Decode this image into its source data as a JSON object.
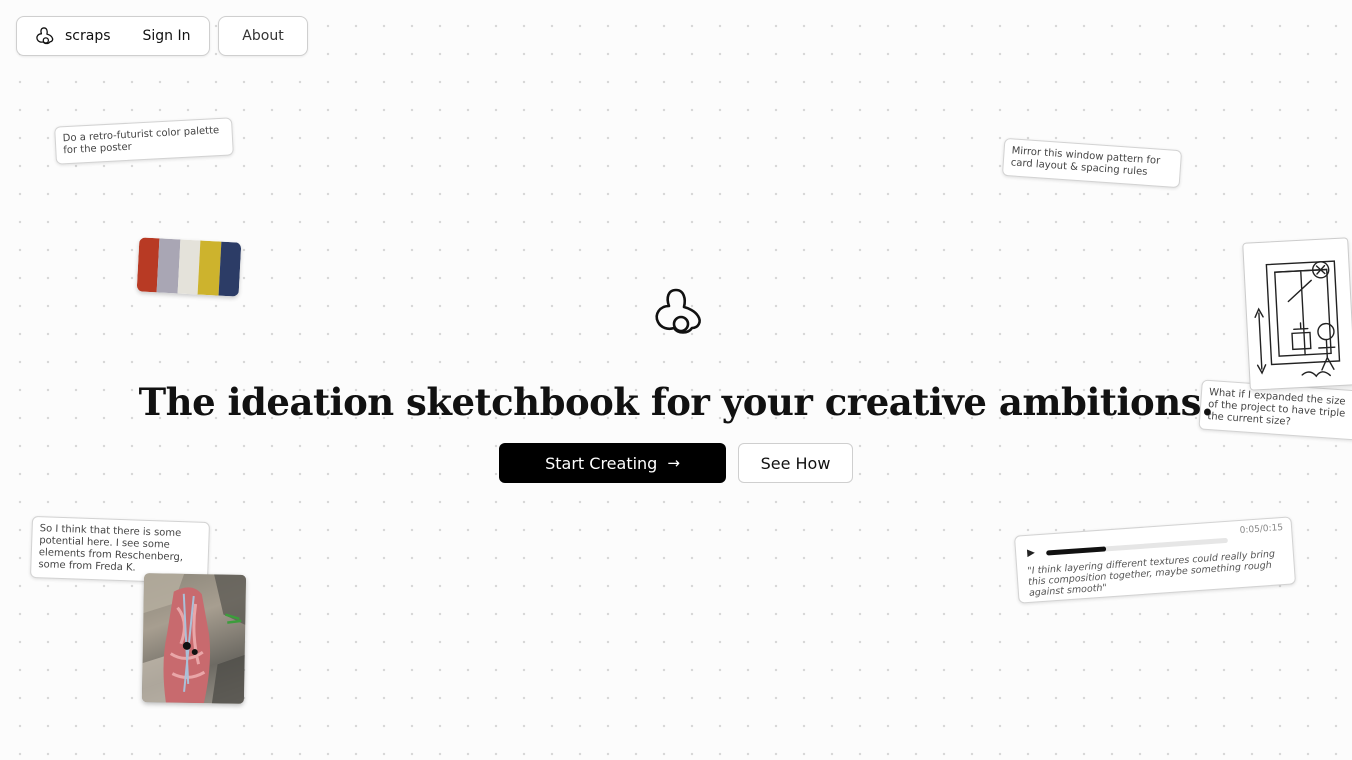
{
  "nav": {
    "brand": "scraps",
    "sign_in": "Sign In",
    "about": "About"
  },
  "hero": {
    "headline": "The ideation sketchbook for your creative ambitions.",
    "primary_button": "Start Creating",
    "primary_button_icon": "arrow-right-icon",
    "secondary_button": "See How"
  },
  "notes": {
    "palette_prompt": "Do a retro-futurist color palette for the poster",
    "window_pattern": "Mirror this window pattern for card layout & spacing rules",
    "expand_size": "What if I expanded the size of the project to have triple the current size?",
    "collage_comment": "So I think that there is some potential here. I see some elements from Reschenberg, some from Freda K."
  },
  "palette": {
    "colors": [
      "#b83a24",
      "#a9a6b4",
      "#e4e2da",
      "#cdb32d",
      "#2c3c66"
    ]
  },
  "audio": {
    "time": "0:05/0:15",
    "progress": 0.33,
    "quote": "\"I think layering different textures could really bring this composition together, maybe something rough against smooth\""
  },
  "colors": {
    "primary": "#000000",
    "background": "#fcfcfc"
  }
}
